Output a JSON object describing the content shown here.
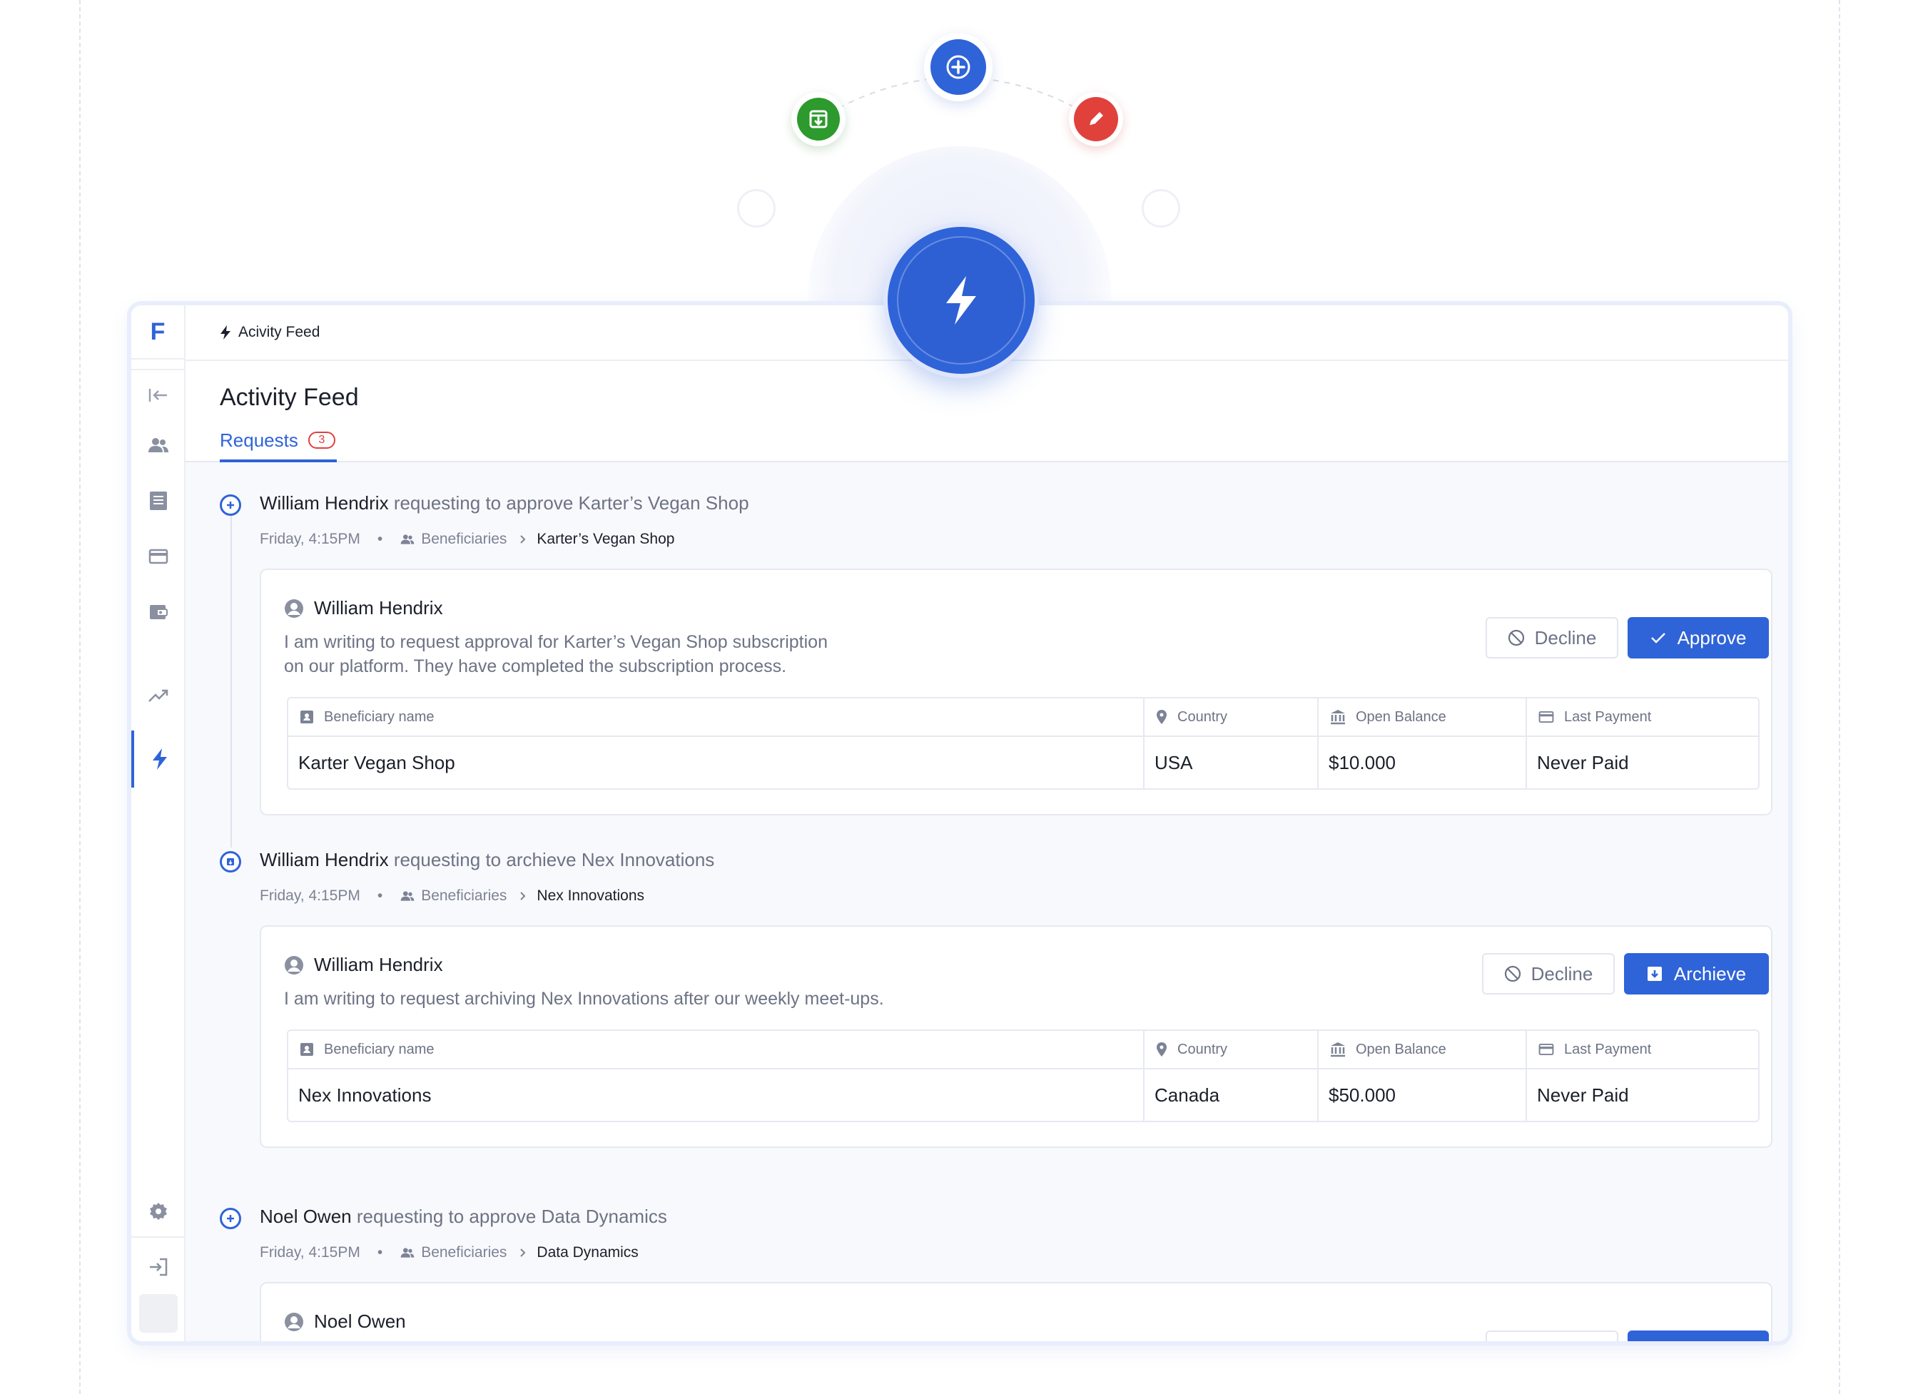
{
  "topbar": {
    "crumb": "Acivity Feed"
  },
  "sidebar": {
    "logo": "F"
  },
  "page": {
    "title": "Activity Feed"
  },
  "tabs": [
    {
      "label": "Requests",
      "badge": "3"
    }
  ],
  "table_headers": {
    "name": "Beneficiary name",
    "country": "Country",
    "balance": "Open Balance",
    "payment": "Last Payment"
  },
  "entries": [
    {
      "user": "William Hendrix",
      "action": "requesting to approve Karter’s Vegan Shop",
      "time": "Friday, 4:15PM",
      "category": "Beneficiaries",
      "target": "Karter’s Vegan Shop",
      "card": {
        "user": "William Hendrix",
        "message_line1": "I am writing to request approval for Karter’s Vegan Shop subscription",
        "message_line2": "on our platform. They have completed the subscription process.",
        "decline_label": "Decline",
        "primary_label": "Approve",
        "row": {
          "name": "Karter Vegan Shop",
          "country": "USA",
          "balance": "$10.000",
          "payment": "Never Paid"
        }
      }
    },
    {
      "user": "William Hendrix",
      "action": "requesting to archieve Nex Innovations",
      "time": "Friday, 4:15PM",
      "category": "Beneficiaries",
      "target": "Nex Innovations",
      "card": {
        "user": "William Hendrix",
        "message_line1": "I am writing to request archiving Nex Innovations after our weekly meet-ups.",
        "decline_label": "Decline",
        "primary_label": "Archieve",
        "row": {
          "name": "Nex Innovations",
          "country": "Canada",
          "balance": "$50.000",
          "payment": "Never Paid"
        }
      }
    },
    {
      "user": "Noel Owen",
      "action": "requesting to approve Data Dynamics",
      "time": "Friday, 4:15PM",
      "category": "Beneficiaries",
      "target": "Data Dynamics",
      "card": {
        "user": "Noel Owen"
      }
    }
  ],
  "colors": {
    "accent": "#2f63d8",
    "danger": "#e0413b",
    "success": "#2c9a2c",
    "muted": "#6d7385"
  }
}
